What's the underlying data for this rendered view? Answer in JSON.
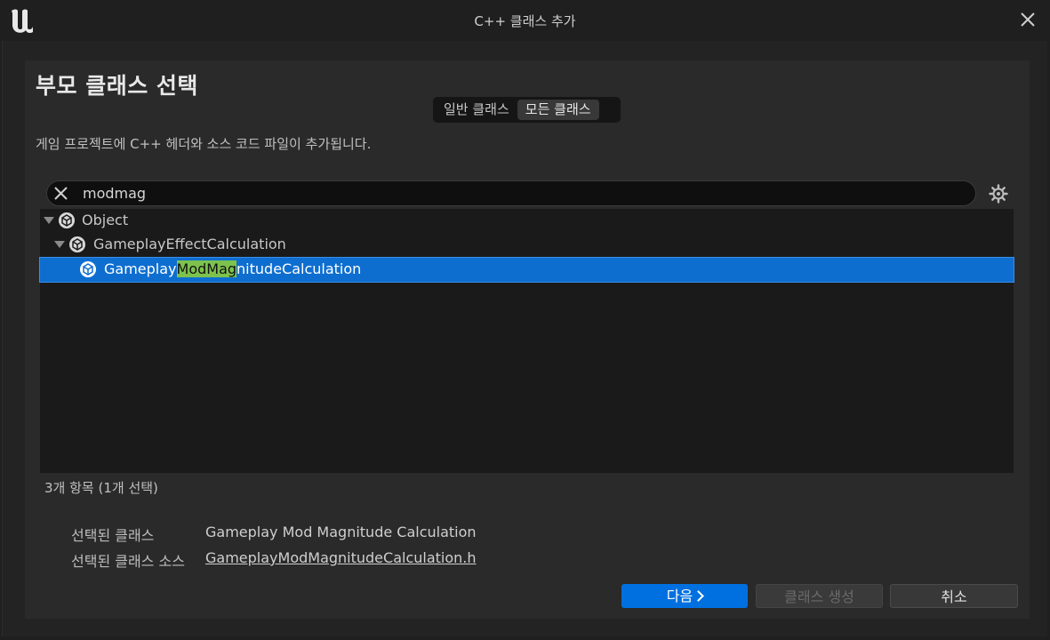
{
  "window": {
    "title": "C++ 클래스 추가"
  },
  "dialog": {
    "heading": "부모 클래스 선택",
    "tabs": [
      {
        "label": "일반 클래스",
        "active": false
      },
      {
        "label": "모든 클래스",
        "active": true
      }
    ],
    "description": "게임 프로젝트에 C++ 헤더와 소스 코드 파일이 추가됩니다."
  },
  "search": {
    "value": "modmag",
    "placeholder": ""
  },
  "tree": {
    "items": [
      {
        "label": "Object",
        "expanded": true,
        "selected": false
      },
      {
        "label": "GameplayEffectCalculation",
        "expanded": true,
        "selected": false
      },
      {
        "label_before": "Gameplay",
        "label_match": "ModMag",
        "label_after": "nitudeCalculation",
        "selected": true
      }
    ],
    "highlight_color": "#7dc24d",
    "selection_color": "#0e6ed0"
  },
  "status": {
    "count_text": "3개 항목 (1개 선택)"
  },
  "info": {
    "selected_class_label": "선택된 클래스",
    "selected_class_value": "Gameplay Mod Magnitude Calculation",
    "selected_source_label": "선택된 클래스 소스",
    "selected_source_value": "GameplayModMagnitudeCalculation.h"
  },
  "buttons": {
    "next": "다음",
    "create": "클래스 생성",
    "cancel": "취소",
    "accent_color": "#0070e0"
  },
  "icons": [
    "unreal-logo-icon",
    "close-icon",
    "clear-search-icon",
    "settings-gear-icon",
    "class-icon",
    "expand-arrow-icon",
    "chevron-right-icon"
  ]
}
